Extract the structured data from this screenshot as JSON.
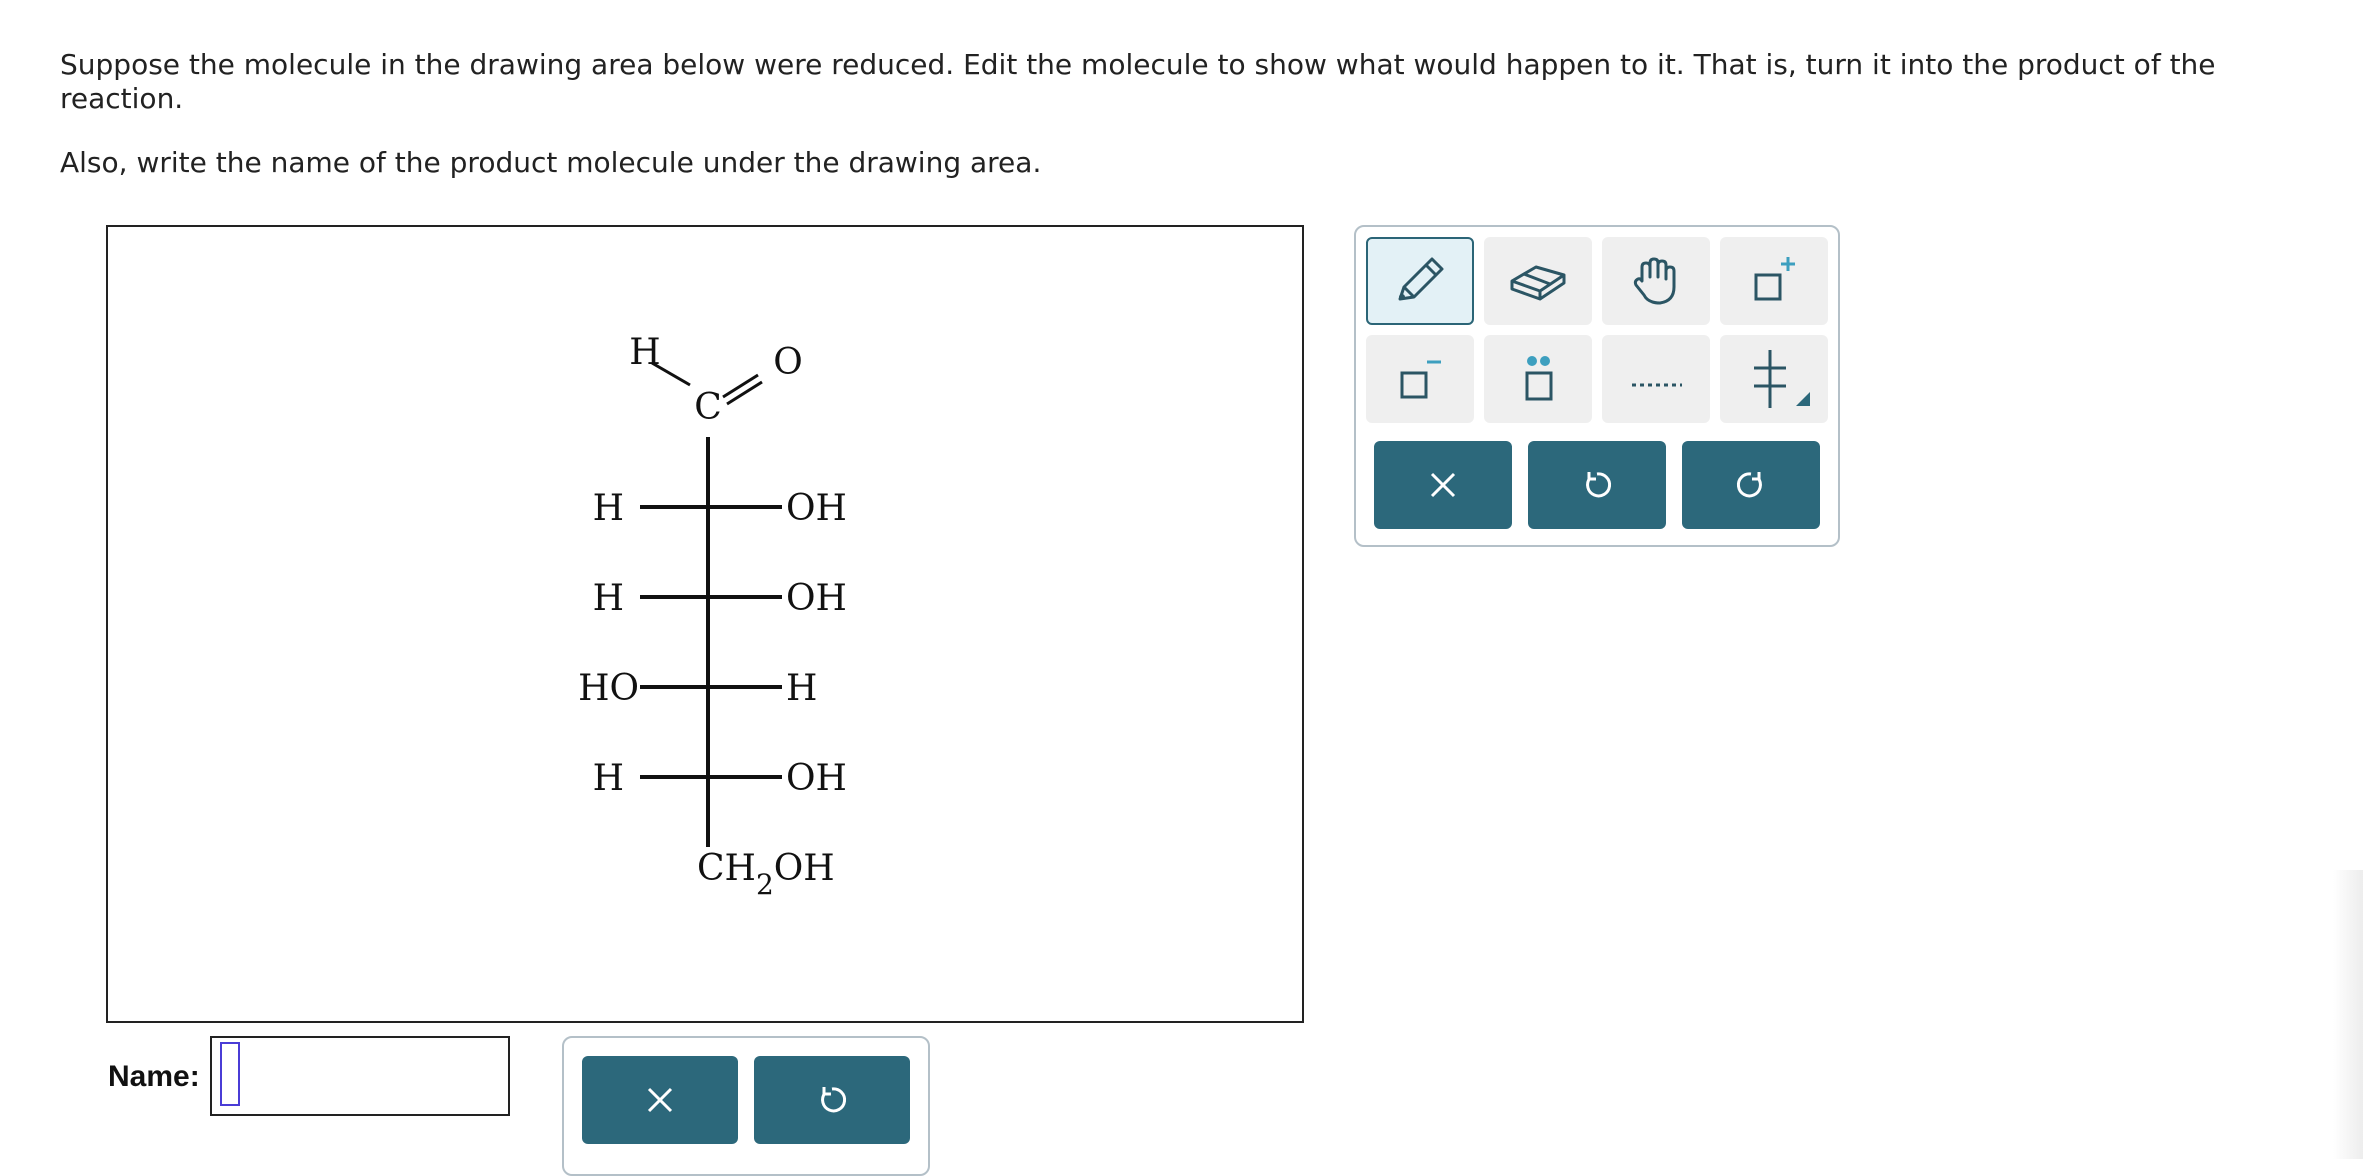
{
  "question": {
    "line1": "Suppose the molecule in the drawing area below were reduced. Edit the molecule to show what would happen to it. That is, turn it into the product of the reaction.",
    "line2": "Also, write the name of the product molecule under the drawing area."
  },
  "molecule": {
    "top_h": "H",
    "carbonyl_c": "C",
    "carbonyl_o": "O",
    "rows": [
      {
        "left": "H",
        "right": "OH"
      },
      {
        "left": "H",
        "right": "OH"
      },
      {
        "left": "HO",
        "right": "H"
      },
      {
        "left": "H",
        "right": "OH"
      }
    ],
    "bottom_group": "CH",
    "bottom_sub": "2",
    "bottom_tail": "OH"
  },
  "toolbar": {
    "tools": [
      "pencil-icon",
      "eraser-icon",
      "hand-icon",
      "add-charge-icon",
      "remove-charge-icon",
      "lone-pair-icon",
      "dotted-bond-icon",
      "fischer-cross-icon"
    ],
    "actions": [
      "clear-icon",
      "undo-icon",
      "redo-icon"
    ],
    "accent_color": "#2c687b",
    "active_tool": "pencil-icon"
  },
  "name_field": {
    "label": "Name:",
    "value": ""
  },
  "name_toolbar": {
    "actions": [
      "clear-icon",
      "undo-icon"
    ]
  }
}
